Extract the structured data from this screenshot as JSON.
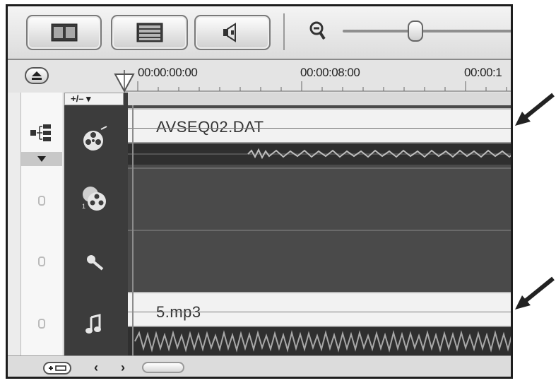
{
  "toolbar": {
    "storyboard_view_label": "",
    "timeline_view_label": "",
    "audio_view_label": "",
    "zoom": {
      "level": 0.5
    }
  },
  "ruler": {
    "timecodes": [
      "00:00:00:00",
      "00:00:08:00",
      "00:00:1"
    ]
  },
  "track_header": {
    "add_remove_label": "+/– ▾"
  },
  "tracks": {
    "video_clip_name": "AVSEQ02.DAT",
    "music_clip_name": "5.mp3"
  }
}
